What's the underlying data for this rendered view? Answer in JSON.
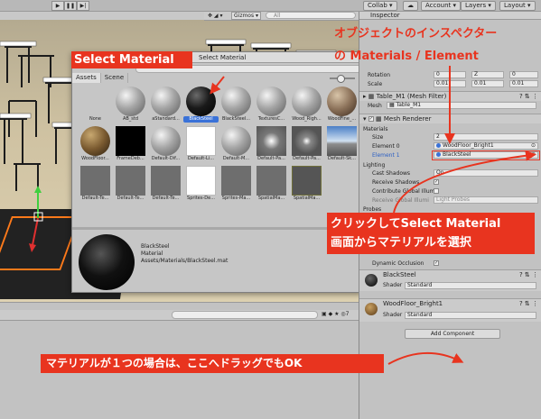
{
  "toolbar": {
    "collab": "Collab",
    "account": "Account",
    "layers": "Layers",
    "layout": "Layout",
    "gizmos": "Gizmos",
    "search_placeholder": "All"
  },
  "dialog": {
    "title": "Select Material",
    "tabs": [
      "Assets",
      "Scene"
    ],
    "items": [
      {
        "label": "None",
        "kind": "none"
      },
      {
        "label": "AB_std",
        "kind": "grey"
      },
      {
        "label": "aStandard...",
        "kind": "grey"
      },
      {
        "label": "BlackSteel",
        "kind": "black",
        "selected": true
      },
      {
        "label": "BlackSteel...",
        "kind": "grey"
      },
      {
        "label": "TexturesC...",
        "kind": "grey"
      },
      {
        "label": "Wood_Righ...",
        "kind": "grey"
      },
      {
        "label": "WoodFine_...",
        "kind": "wood"
      },
      {
        "label": "WoodFloor...",
        "kind": "woodfloor"
      },
      {
        "label": "FrameDeb...",
        "kind": "blackflat"
      },
      {
        "label": "Default-Dif...",
        "kind": "grey"
      },
      {
        "label": "Default-Li...",
        "kind": "white"
      },
      {
        "label": "Default-M...",
        "kind": "grey"
      },
      {
        "label": "Default-Pa...",
        "kind": "particle"
      },
      {
        "label": "Default-Pa...",
        "kind": "particle2"
      },
      {
        "label": "Default-Sk...",
        "kind": "sky"
      },
      {
        "label": "Default-Te...",
        "kind": "flat"
      },
      {
        "label": "Default-Te...",
        "kind": "flat"
      },
      {
        "label": "Default-Te...",
        "kind": "flat"
      },
      {
        "label": "Sprites-De...",
        "kind": "white"
      },
      {
        "label": "Sprites-Ma...",
        "kind": "flat"
      },
      {
        "label": "SpatialMa...",
        "kind": "flat"
      },
      {
        "label": "SpatialMa...",
        "kind": "mesh"
      }
    ],
    "preview": {
      "name": "BlackSteel",
      "type": "Material",
      "path": "Assets/Materials/BlackSteel.mat"
    }
  },
  "inspector": {
    "tab": "Inspector",
    "rotation_label": "Rotation",
    "scale_label": "Scale",
    "rotation": {
      "x": "0",
      "y": "Z",
      "z": "0"
    },
    "scale": {
      "x": "0.01",
      "y": "0.01",
      "z": "0.01"
    },
    "mesh_filter_title": "Table_M1 (Mesh Filter)",
    "mesh_label": "Mesh",
    "mesh_value": "Table_M1",
    "mesh_renderer_title": "Mesh Renderer",
    "materials_label": "Materials",
    "size_label": "Size",
    "size_value": "2",
    "element0_label": "Element 0",
    "element0_value": "WoodFloor_Bright1",
    "element1_label": "Element 1",
    "element1_value": "BlackSteel",
    "lighting_label": "Lighting",
    "cast_shadows_label": "Cast Shadows",
    "cast_shadows_value": "On",
    "receive_shadows_label": "Receive Shadows",
    "contribute_gi_label": "Contribute Global Illum",
    "receive_gi_label": "Receive Global Illumi",
    "receive_gi_value": "Light Probes",
    "probes_label": "Probes",
    "dynamic_occlusion_label": "Dynamic Occlusion",
    "mat1_name": "BlackSteel",
    "mat2_name": "WoodFloor_Bright1",
    "shader_label": "Shader",
    "shader_value": "Standard",
    "add_component": "Add Component"
  },
  "annotations": {
    "select_material": "Select Material",
    "inspector_title_line1": "オブジェクトのインスペクター",
    "inspector_title_line2": "の Materials / Element",
    "click_line1": "クリックしてSelect Material",
    "click_line2": "画面からマテリアルを選択",
    "drag_hint": "マテリアルが１つの場合は、ここへドラッグでもOK"
  },
  "colors": {
    "annotation_red": "#e8341f",
    "selection_blue": "#3a72d8",
    "selection_orange": "#ff7a1a"
  }
}
